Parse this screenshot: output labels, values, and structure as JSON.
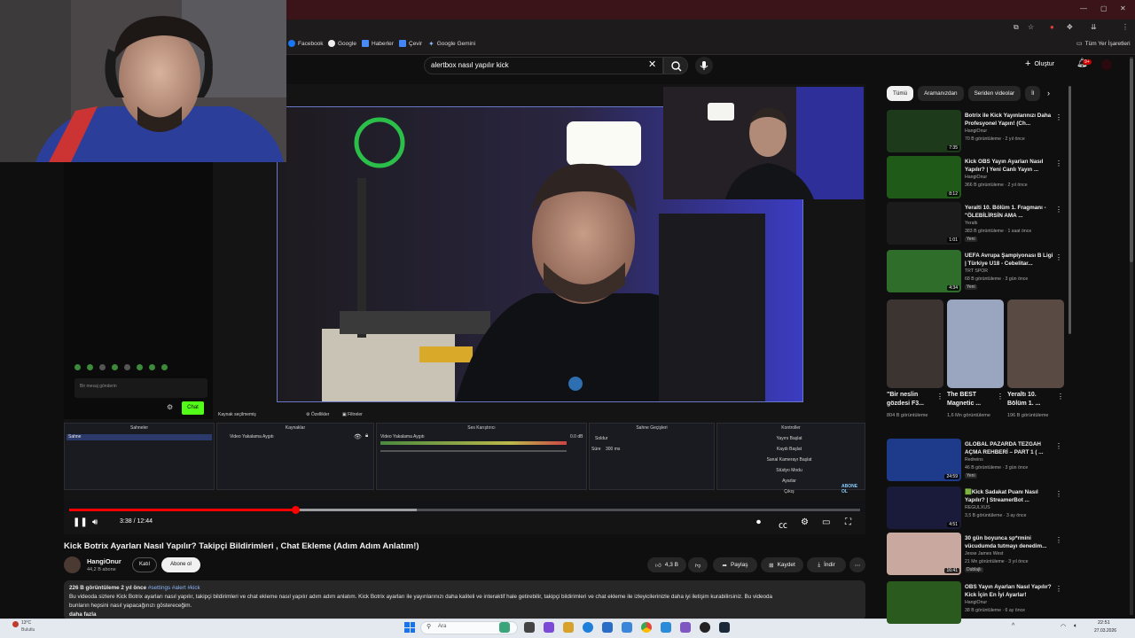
{
  "browser": {
    "bookmarks": [
      "Facebook",
      "Google",
      "Haberler",
      "Çevir",
      "Google Gemini"
    ],
    "all_bookmarks_label": "Tüm Yer İşaretleri"
  },
  "youtube_header": {
    "search_value": "alertbox nasıl yapılır kick",
    "create_label": "Oluştur",
    "notification_badge": "9+"
  },
  "obs": {
    "chat_button": "Chat",
    "chat_placeholder": "Bir mesaj gönderin",
    "source_none": "Kaynak seçilmemiş",
    "properties": "Özellikler",
    "filters": "Filtreler",
    "docks": {
      "scenes": "Sahneler",
      "sources": "Kaynaklar",
      "audio_mixer": "Ses Karıştırıcı",
      "transitions": "Sahne Geçişleri",
      "controls": "Kontroller"
    },
    "scene_item": "Sahne",
    "source_item": "Video Yakalama Aygıtı",
    "mixer_item": "Video Yakalama Aygıtı",
    "mixer_db": "0.0 dB",
    "transition_type": "Soldur",
    "duration_label": "Süre",
    "duration_value": "300 ms",
    "controls": [
      "Yayını Başlat",
      "Kaydı Başlat",
      "Sanal Kamerayı Başlat",
      "Stüdyo Modu",
      "Ayarlar",
      "Çıkış"
    ],
    "sponsor_text": "ABONE OL"
  },
  "player": {
    "current_time": "3:38",
    "duration": "12:44",
    "progress_fraction": 0.286,
    "buffered_fraction": 0.44
  },
  "video": {
    "title": "Kick Botrix Ayarları Nasıl Yapılır? Takipçi Bildirimleri , Chat Ekleme (Adım Adım Anlatım!)",
    "channel": "HangiOnur",
    "subscribers": "44,2 B abone",
    "join_label": "Katıl",
    "subscribe_label": "Abone ol",
    "likes": "4,3 B",
    "share_label": "Paylaş",
    "save_label": "Kaydet",
    "download_label": "İndir",
    "views_date": "226 B görüntüleme  2 yıl önce",
    "hashtags": "#settings #alert #kick",
    "description_line1": "Bu videoda sizlere Kick Botrix ayarları nasıl yapılır, takipçi bildirimleri ve chat ekleme nasıl yapılır adım adım anlatım. Kick Botrix ayarları ile yayınlarınızı daha kaliteli ve interaktif hale getirebilir, takipçi bildirimleri ve chat ekleme ile izleyicilerinizle daha iyi iletişim kurabilirsiniz. Bu videoda",
    "description_line2": "bunların hepsini nasıl yapacağınızı göstereceğim.",
    "more_label": "daha fazla"
  },
  "sidebar": {
    "chips": [
      "Tümü",
      "Aramanızdan",
      "Seriden videolar",
      "İl"
    ],
    "recommendations": [
      {
        "title": "Botrix ile Kick Yayınlarınızı Daha Profesyonel Yapın! (Ch...",
        "channel": "HangiOnur",
        "stats": "70 B görüntüleme · 2 yıl önce",
        "duration": "7:35",
        "badge": "",
        "thumb_color": "#1d3b1a"
      },
      {
        "title": "Kick OBS Yayın Ayarları Nasıl Yapılır? | Yeni Canlı Yayın ...",
        "channel": "HangiOnur",
        "stats": "366 B görüntüleme · 2 yıl önce",
        "duration": "8:12",
        "badge": "",
        "thumb_color": "#1f5a18"
      },
      {
        "title": "Yeralti 10. Bölüm 1. Fragmanı - \"ÖLEBİLİRSİN AMA ...",
        "channel": "Yeraltı",
        "stats": "383 B görüntüleme · 1 saat önce",
        "duration": "1:01",
        "badge": "Yeni",
        "thumb_color": "#1b1b1b"
      },
      {
        "title": "UEFA Avrupa Şampiyonası B Ligi | Türkiye U18 - Cebelitar...",
        "channel": "TRT SPOR",
        "stats": "68 B görüntüleme · 3 gün önce",
        "duration": "4:34",
        "badge": "Yeni",
        "thumb_color": "#2f6e2a"
      },
      {
        "title": "GLOBAL PAZARDA TEZGAH AÇMA REHBERİ – PART 1 ( ...",
        "channel": "Redreins",
        "stats": "46 B görüntüleme · 3 gün önce",
        "duration": "24:59",
        "badge": "Yeni",
        "thumb_color": "#1e3a8a"
      },
      {
        "title": "🟩Kick Sadakat Puanı Nasıl Yapılır? | StreamerBot ...",
        "channel": "REGULXUS",
        "stats": "3,5 B görüntüleme · 3 ay önce",
        "duration": "4:51",
        "badge": "",
        "thumb_color": "#1a1a3a"
      },
      {
        "title": "30 gün boyunca sp*rmini vücudumda tutmayı denedim...",
        "channel": "Jesse James West",
        "stats": "21 Mn görüntüleme · 3 yıl önce",
        "duration": "16:41",
        "badge": "Dublajlı",
        "thumb_color": "#c9a8a0"
      },
      {
        "title": "OBS Yayın Ayarları Nasıl Yapılır? Kick İçin En İyi Ayarlar!",
        "channel": "HangiOnur",
        "stats": "38 B görüntüleme · 6 ay önce",
        "duration": "",
        "badge": "",
        "thumb_color": "#2a5a1e"
      }
    ],
    "shorts": [
      {
        "title": "\"Bir neslin gözdesi F3...",
        "views": "804 B görüntüleme",
        "color": "#3b3430"
      },
      {
        "title": "The BEST Magnetic ...",
        "views": "1,6 Mn görüntüleme",
        "color": "#9aa6c0"
      },
      {
        "title": "Yeraltı 10. Bölüm 1. ...",
        "views": "196 B görüntüleme",
        "color": "#5a4a44"
      }
    ]
  },
  "taskbar": {
    "weather_temp": "13°C",
    "weather_desc": "Bulutlu",
    "search_placeholder": "Ara",
    "time": "22:51",
    "date": "27.03.2026"
  }
}
